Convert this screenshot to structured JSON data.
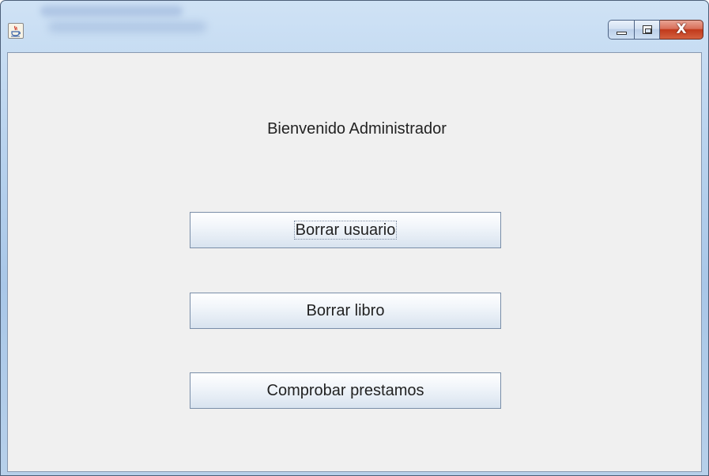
{
  "window": {
    "title": "",
    "icon": "java-coffee-icon",
    "controls": {
      "minimize": "minimize-icon",
      "maximize": "maximize-icon",
      "close": "X"
    }
  },
  "main": {
    "welcome_text": "Bienvenido Administrador",
    "buttons": [
      {
        "label": "Borrar usuario"
      },
      {
        "label": "Borrar libro"
      },
      {
        "label": "Comprobar prestamos"
      }
    ]
  },
  "colors": {
    "panel_background": "#f0f0f0",
    "close_button": "#c0391b",
    "titlebar": "#b9d3ee"
  }
}
